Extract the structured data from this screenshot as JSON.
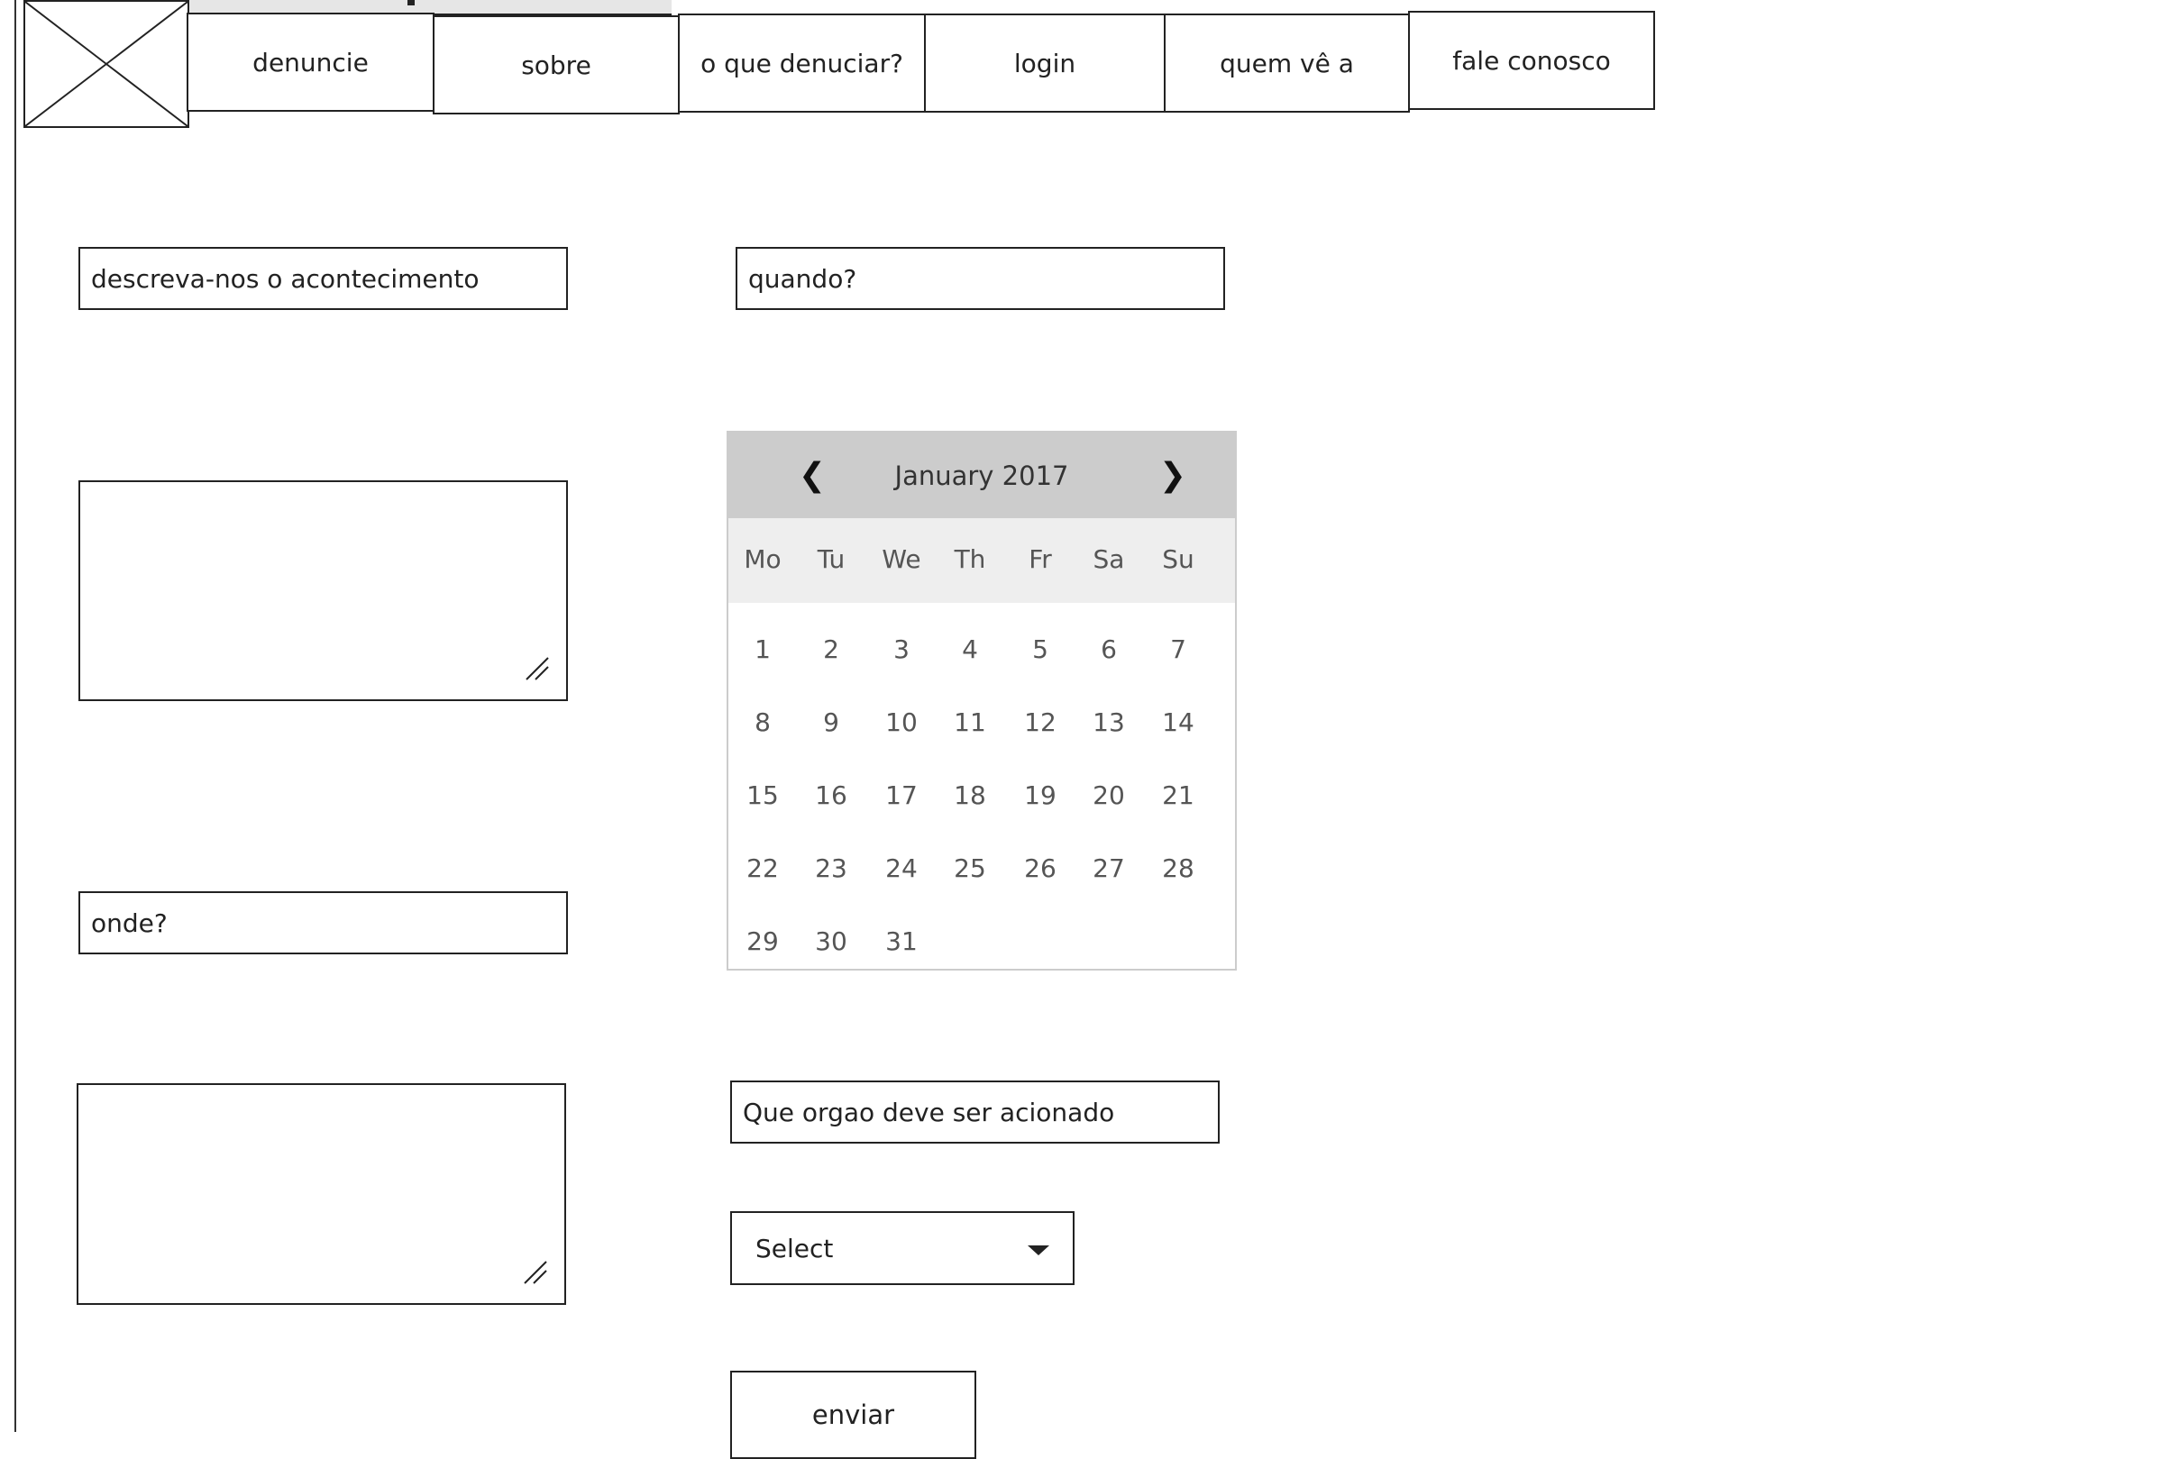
{
  "nav": {
    "tabs": [
      {
        "label": "denuncie"
      },
      {
        "label": "sobre"
      },
      {
        "label": "o que denuciar?"
      },
      {
        "label": "login"
      },
      {
        "label": "quem vê a"
      },
      {
        "label": "fale conosco"
      }
    ]
  },
  "form": {
    "description_field": "descreva-nos o acontecimento",
    "when_field": "quando?",
    "where_field": "onde?",
    "agency_field": "Que orgao deve ser acionado",
    "select": {
      "selected": "Select"
    },
    "submit_label": "enviar"
  },
  "calendar": {
    "month_label": "January 2017",
    "prev_icon": "❮",
    "next_icon": "❯",
    "weekdays": [
      "Mo",
      "Tu",
      "We",
      "Th",
      "Fr",
      "Sa",
      "Su"
    ],
    "days": [
      "1",
      "2",
      "3",
      "4",
      "5",
      "6",
      "7",
      "8",
      "9",
      "10",
      "11",
      "12",
      "13",
      "14",
      "15",
      "16",
      "17",
      "18",
      "19",
      "20",
      "21",
      "22",
      "23",
      "24",
      "25",
      "26",
      "27",
      "28",
      "29",
      "30",
      "31"
    ]
  },
  "icons": {
    "logo_placeholder": "image-placeholder-icon",
    "resize_grip": "resize-grip-icon",
    "select_caret": "caret-down-icon"
  },
  "colors": {
    "calendar_header": "#cccccc",
    "calendar_weekdays": "#eeeeee",
    "border": "#222222"
  }
}
